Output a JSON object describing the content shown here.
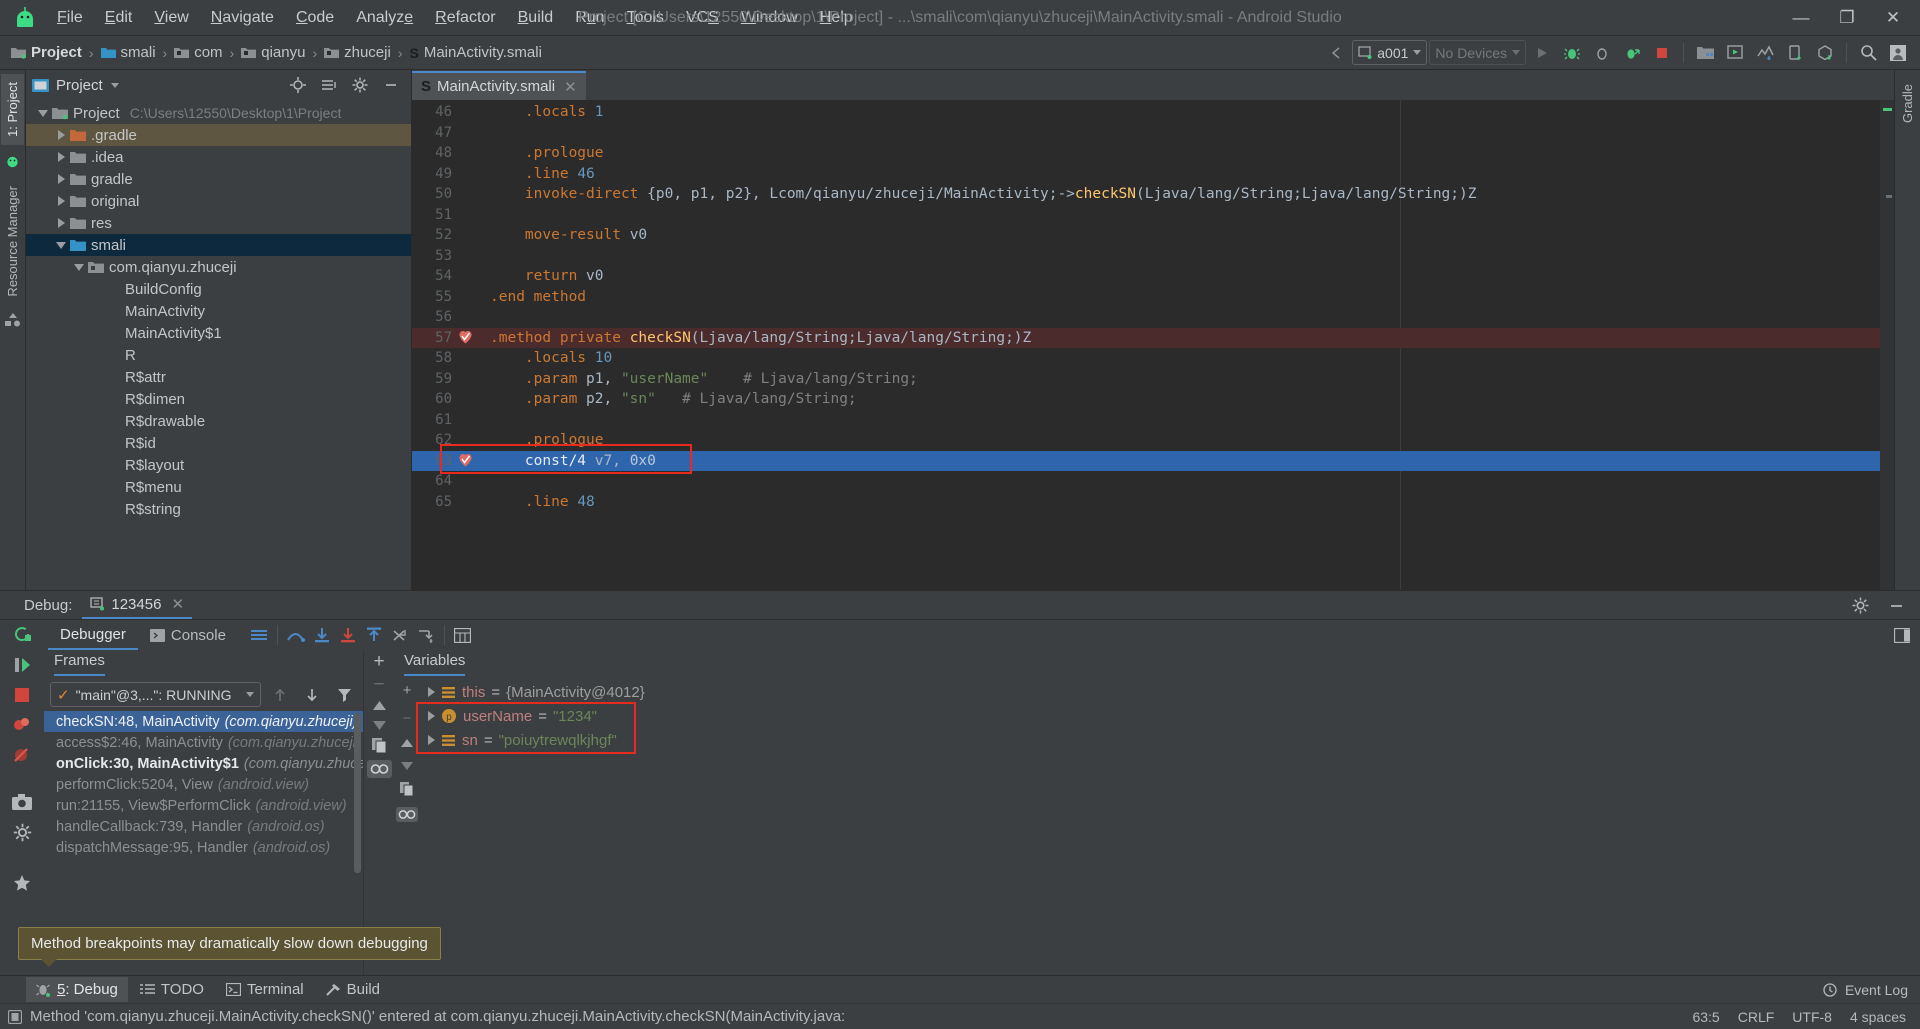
{
  "window": {
    "title": "Project [C:\\Users\\12550\\Desktop\\1\\Project] - ...\\smali\\com\\qianyu\\zhuceji\\MainActivity.smali - Android Studio",
    "minimize": "—",
    "maximize": "❐",
    "close": "✕"
  },
  "menubar": {
    "items": [
      {
        "label": "File"
      },
      {
        "label": "Edit"
      },
      {
        "label": "View"
      },
      {
        "label": "Navigate"
      },
      {
        "label": "Code"
      },
      {
        "label": "Analyze"
      },
      {
        "label": "Refactor"
      },
      {
        "label": "Build"
      },
      {
        "label": "Run"
      },
      {
        "label": "Tools"
      },
      {
        "label": "VCS"
      },
      {
        "label": "Window"
      },
      {
        "label": "Help"
      }
    ]
  },
  "navbar": {
    "breadcrumbs": [
      {
        "label": "Project",
        "icon": "project-folder-icon"
      },
      {
        "label": "smali",
        "icon": "folder-blue-icon"
      },
      {
        "label": "com",
        "icon": "package-icon"
      },
      {
        "label": "qianyu",
        "icon": "package-icon"
      },
      {
        "label": "zhuceji",
        "icon": "package-icon"
      },
      {
        "label": "MainActivity.smali",
        "icon": "smali-file-icon"
      }
    ],
    "separator": "›",
    "run_config": "a001",
    "device_selector": "No Devices"
  },
  "left_strip": {
    "tabs": [
      {
        "label": "1: Project",
        "active": true
      },
      {
        "label": "Resource Manager",
        "active": false
      }
    ]
  },
  "right_strip": {
    "tabs": [
      {
        "label": "Gradle"
      }
    ]
  },
  "project_panel": {
    "title": "Project",
    "tree": [
      {
        "label": "Project",
        "sub": "C:\\Users\\12550\\Desktop\\1\\Project",
        "indent": 0,
        "twisty": "down",
        "icon": "project-root-icon",
        "state": "normal"
      },
      {
        "label": ".gradle",
        "indent": 1,
        "twisty": "right",
        "icon": "folder-orange-icon",
        "state": "sel-grey"
      },
      {
        "label": ".idea",
        "indent": 1,
        "twisty": "right",
        "icon": "folder-grey-icon",
        "state": "normal"
      },
      {
        "label": "gradle",
        "indent": 1,
        "twisty": "right",
        "icon": "folder-grey-icon",
        "state": "normal"
      },
      {
        "label": "original",
        "indent": 1,
        "twisty": "right",
        "icon": "folder-grey-icon",
        "state": "normal"
      },
      {
        "label": "res",
        "indent": 1,
        "twisty": "right",
        "icon": "folder-grey-icon",
        "state": "normal"
      },
      {
        "label": "smali",
        "indent": 1,
        "twisty": "down",
        "icon": "folder-blue-icon",
        "state": "sel-blue"
      },
      {
        "label": "com.qianyu.zhuceji",
        "indent": 2,
        "twisty": "down",
        "icon": "package-icon",
        "state": "normal"
      },
      {
        "label": "BuildConfig",
        "indent": 3,
        "twisty": "none",
        "icon": "smali-file-icon",
        "state": "normal"
      },
      {
        "label": "MainActivity",
        "indent": 3,
        "twisty": "none",
        "icon": "smali-file-icon",
        "state": "normal"
      },
      {
        "label": "MainActivity$1",
        "indent": 3,
        "twisty": "none",
        "icon": "smali-file-icon",
        "state": "normal"
      },
      {
        "label": "R",
        "indent": 3,
        "twisty": "none",
        "icon": "smali-file-icon",
        "state": "normal"
      },
      {
        "label": "R$attr",
        "indent": 3,
        "twisty": "none",
        "icon": "smali-file-icon",
        "state": "normal"
      },
      {
        "label": "R$dimen",
        "indent": 3,
        "twisty": "none",
        "icon": "smali-file-icon",
        "state": "normal"
      },
      {
        "label": "R$drawable",
        "indent": 3,
        "twisty": "none",
        "icon": "smali-file-icon",
        "state": "normal"
      },
      {
        "label": "R$id",
        "indent": 3,
        "twisty": "none",
        "icon": "smali-file-icon",
        "state": "normal"
      },
      {
        "label": "R$layout",
        "indent": 3,
        "twisty": "none",
        "icon": "smali-file-icon",
        "state": "normal"
      },
      {
        "label": "R$menu",
        "indent": 3,
        "twisty": "none",
        "icon": "smali-file-icon",
        "state": "normal"
      },
      {
        "label": "R$string",
        "indent": 3,
        "twisty": "none",
        "icon": "smali-file-icon",
        "state": "normal"
      }
    ]
  },
  "editor": {
    "tab": {
      "label": "MainActivity.smali",
      "close": "✕",
      "icon": "smali-file-icon"
    },
    "lines": [
      {
        "num": 46,
        "highlight": "none",
        "breakpoint": false,
        "tokens": [
          {
            "t": "    .locals ",
            "c": "kw"
          },
          {
            "t": "1",
            "c": "num"
          }
        ]
      },
      {
        "num": 47,
        "highlight": "none",
        "breakpoint": false,
        "tokens": []
      },
      {
        "num": 48,
        "highlight": "none",
        "breakpoint": false,
        "tokens": [
          {
            "t": "    .prologue",
            "c": "kw"
          }
        ]
      },
      {
        "num": 49,
        "highlight": "none",
        "breakpoint": false,
        "tokens": [
          {
            "t": "    .line ",
            "c": "kw"
          },
          {
            "t": "46",
            "c": "num"
          }
        ]
      },
      {
        "num": 50,
        "highlight": "none",
        "breakpoint": false,
        "tokens": [
          {
            "t": "    invoke-direct ",
            "c": "kw"
          },
          {
            "t": "{p0, p1, p2}, ",
            "c": "plain"
          },
          {
            "t": "Lcom/qianyu/zhuceji/MainActivity;->",
            "c": "id"
          },
          {
            "t": "checkSN",
            "c": "mth"
          },
          {
            "t": "(Ljava/lang/String;Ljava/lang/String;)Z",
            "c": "id"
          }
        ]
      },
      {
        "num": 51,
        "highlight": "none",
        "breakpoint": false,
        "tokens": []
      },
      {
        "num": 52,
        "highlight": "none",
        "breakpoint": false,
        "tokens": [
          {
            "t": "    move-result ",
            "c": "kw"
          },
          {
            "t": "v0",
            "c": "plain"
          }
        ]
      },
      {
        "num": 53,
        "highlight": "none",
        "breakpoint": false,
        "tokens": []
      },
      {
        "num": 54,
        "highlight": "none",
        "breakpoint": false,
        "tokens": [
          {
            "t": "    return ",
            "c": "kw"
          },
          {
            "t": "v0",
            "c": "plain"
          }
        ]
      },
      {
        "num": 55,
        "highlight": "none",
        "breakpoint": false,
        "tokens": [
          {
            "t": ".end method",
            "c": "kw"
          }
        ]
      },
      {
        "num": 56,
        "highlight": "none",
        "breakpoint": false,
        "tokens": []
      },
      {
        "num": 57,
        "highlight": "red",
        "breakpoint": true,
        "tokens": [
          {
            "t": ".method private ",
            "c": "kw"
          },
          {
            "t": "checkSN",
            "c": "mth"
          },
          {
            "t": "(Ljava/lang/String;Ljava/lang/String;)Z",
            "c": "id"
          }
        ]
      },
      {
        "num": 58,
        "highlight": "none",
        "breakpoint": false,
        "tokens": [
          {
            "t": "    .locals ",
            "c": "kw"
          },
          {
            "t": "10",
            "c": "num"
          }
        ]
      },
      {
        "num": 59,
        "highlight": "none",
        "breakpoint": false,
        "tokens": [
          {
            "t": "    .param ",
            "c": "kw"
          },
          {
            "t": "p1, ",
            "c": "plain"
          },
          {
            "t": "\"userName\"",
            "c": "str"
          },
          {
            "t": "    # Ljava/lang/String;",
            "c": "cmt"
          }
        ]
      },
      {
        "num": 60,
        "highlight": "none",
        "breakpoint": false,
        "tokens": [
          {
            "t": "    .param ",
            "c": "kw"
          },
          {
            "t": "p2, ",
            "c": "plain"
          },
          {
            "t": "\"sn\"",
            "c": "str"
          },
          {
            "t": "   # Ljava/lang/String;",
            "c": "cmt"
          }
        ]
      },
      {
        "num": 61,
        "highlight": "none",
        "breakpoint": false,
        "tokens": []
      },
      {
        "num": 62,
        "highlight": "none",
        "breakpoint": false,
        "tokens": [
          {
            "t": "    .prologue",
            "c": "kw"
          }
        ]
      },
      {
        "num": 63,
        "highlight": "blue",
        "breakpoint": true,
        "tokens": [
          {
            "t": "    const/4 ",
            "c": "kw"
          },
          {
            "t": "v7, ",
            "c": "plain"
          },
          {
            "t": "0x0",
            "c": "num"
          }
        ]
      },
      {
        "num": 64,
        "highlight": "none",
        "breakpoint": false,
        "tokens": []
      },
      {
        "num": 65,
        "highlight": "none",
        "breakpoint": false,
        "tokens": [
          {
            "t": "    .line ",
            "c": "kw"
          },
          {
            "t": "48",
            "c": "num"
          }
        ]
      }
    ]
  },
  "debug": {
    "label": "Debug:",
    "session": "123456",
    "session_close": "✕",
    "tabs": [
      {
        "label": "Debugger",
        "active": true,
        "icon": "debugger-icon"
      },
      {
        "label": "Console",
        "active": false,
        "icon": "console-icon"
      }
    ],
    "frames": {
      "title": "Frames",
      "thread": "\"main\"@3,...\": RUNNING",
      "items": [
        {
          "method": "checkSN:48, MainActivity",
          "pkg": "(com.qianyu.zhuceji)",
          "state": "sel"
        },
        {
          "method": "access$2:46, MainActivity",
          "pkg": "(com.qianyu.zhuceji)",
          "state": "dim"
        },
        {
          "method": "onClick:30, MainActivity$1",
          "pkg": "(com.qianyu.zhuceji)",
          "state": "bold"
        },
        {
          "method": "performClick:5204, View",
          "pkg": "(android.view)",
          "state": "dim"
        },
        {
          "method": "run:21155, View$PerformClick",
          "pkg": "(android.view)",
          "state": "dim"
        },
        {
          "method": "handleCallback:739, Handler",
          "pkg": "(android.os)",
          "state": "dim"
        },
        {
          "method": "dispatchMessage:95, Handler",
          "pkg": "(android.os)",
          "state": "dim"
        }
      ]
    },
    "variables": {
      "title": "Variables",
      "items": [
        {
          "name": "this",
          "eq": "=",
          "value": "{MainActivity@4012}",
          "kind": "obj",
          "icon": "field-icon"
        },
        {
          "name": "userName",
          "eq": "=",
          "value": "\"1234\"",
          "kind": "str",
          "icon": "param-icon"
        },
        {
          "name": "sn",
          "eq": "=",
          "value": "\"poiuytrewqlkjhgf\"",
          "kind": "str",
          "icon": "field-icon"
        }
      ]
    }
  },
  "tooltip": {
    "text": "Method breakpoints may dramatically slow down debugging"
  },
  "bottom_toolbar": {
    "items": [
      {
        "label": "5: Debug",
        "underline": "5",
        "active": true,
        "icon": "debug-bug-icon"
      },
      {
        "label": "TODO",
        "active": false,
        "icon": "todo-list-icon"
      },
      {
        "label": "Terminal",
        "active": false,
        "icon": "terminal-icon"
      },
      {
        "label": "Build",
        "active": false,
        "icon": "build-hammer-icon"
      }
    ],
    "event_log": "Event Log"
  },
  "statusbar": {
    "message": "Method 'com.qianyu.zhuceji.MainActivity.checkSN()' entered at com.qianyu.zhuceji.MainActivity.checkSN(MainActivity.java:",
    "caret": "63:5",
    "line_sep": "CRLF",
    "encoding": "UTF-8",
    "indent": "4 spaces"
  },
  "colors": {
    "accent_blue": "#4a88c7",
    "selection_blue": "#2f65ad",
    "breakpoint_red": "#e62b1e",
    "highlight_red_bg": "#4b2b2b",
    "panel_bg": "#3c3f41",
    "editor_bg": "#2b2b2b"
  }
}
